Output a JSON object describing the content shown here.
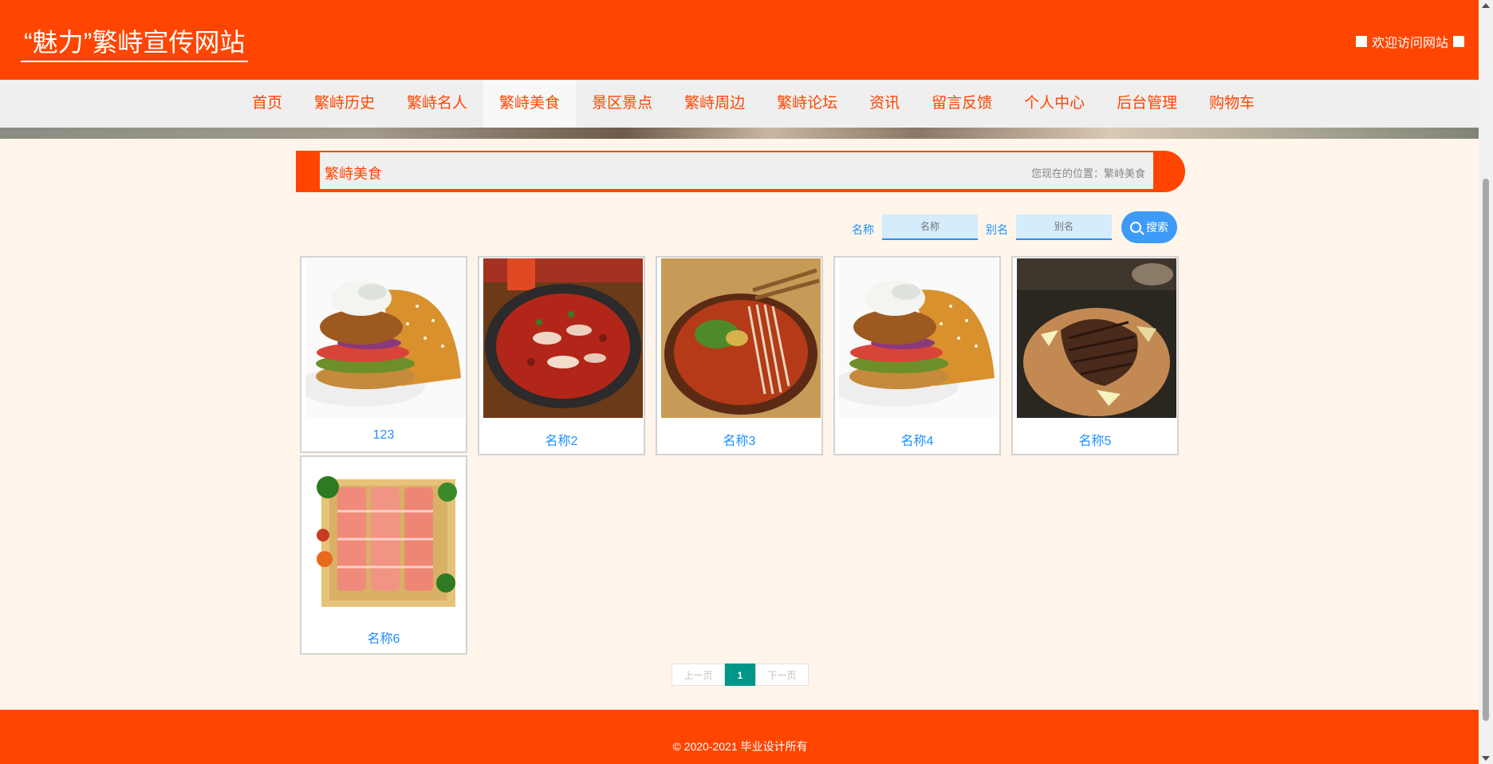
{
  "header": {
    "title": "“魅力”繁峙宣传网站",
    "welcome": "欢迎访问网站"
  },
  "nav": {
    "items": [
      "首页",
      "繁峙历史",
      "繁峙名人",
      "繁峙美食",
      "景区景点",
      "繁峙周边",
      "繁峙论坛",
      "资讯",
      "留言反馈",
      "个人中心",
      "后台管理",
      "购物车"
    ],
    "active": "繁峙美食"
  },
  "section": {
    "title": "繁峙美食",
    "location": "您现在的位置：繁峙美食"
  },
  "search": {
    "name_label": "名称",
    "name_placeholder": "名称",
    "alias_label": "别名",
    "alias_placeholder": "别名",
    "button_label": "搜索"
  },
  "items": [
    {
      "caption": "123",
      "image": "burger"
    },
    {
      "caption": "名称2",
      "image": "spicy-fish"
    },
    {
      "caption": "名称3",
      "image": "noodles"
    },
    {
      "caption": "名称4",
      "image": "burger"
    },
    {
      "caption": "名称5",
      "image": "steak"
    },
    {
      "caption": "名称6",
      "image": "sashimi"
    }
  ],
  "pagination": {
    "prev": "上一页",
    "current": "1",
    "next": "下一页"
  },
  "footer": {
    "copyright": "© 2020-2021 毕业设计所有"
  },
  "colors": {
    "brand": "#ff4500",
    "link": "#1e90ff",
    "page_active": "#009688"
  }
}
